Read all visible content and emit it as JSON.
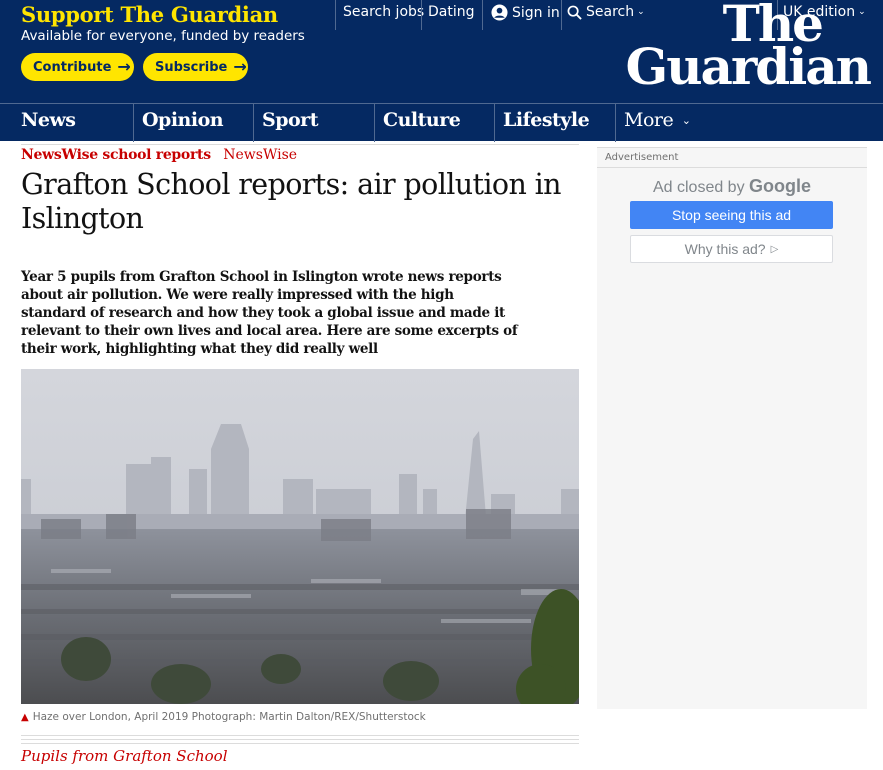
{
  "header": {
    "support_title": "Support The Guardian",
    "support_subtitle": "Available for everyone, funded by readers",
    "contribute_label": "Contribute",
    "subscribe_label": "Subscribe",
    "search_jobs": "Search jobs",
    "dating": "Dating",
    "sign_in": "Sign in",
    "search": "Search",
    "edition": "UK edition",
    "logo_line1": "The",
    "logo_line2": "Guardian",
    "colors": {
      "brand_blue": "#052962",
      "accent_yellow": "#ffe500",
      "news_red": "#c70000"
    }
  },
  "nav": {
    "items": [
      {
        "label": "News"
      },
      {
        "label": "Opinion"
      },
      {
        "label": "Sport"
      },
      {
        "label": "Culture"
      },
      {
        "label": "Lifestyle"
      },
      {
        "label": "More"
      }
    ]
  },
  "article": {
    "series": "NewsWise school reports",
    "section": "NewsWise",
    "headline": "Grafton School reports: air pollution in Islington",
    "standfirst": "Year 5 pupils from Grafton School in Islington wrote news reports about air pollution. We were really impressed with the high standard of research and how they took a global issue and made it relevant to their own lives and local area. Here are some excerpts of their work, highlighting what they did really well",
    "image_caption": "Haze over London, April 2019 Photograph: Martin Dalton/REX/Shutterstock",
    "byline": "Pupils from Grafton School"
  },
  "ad": {
    "label": "Advertisement",
    "closed_prefix": "Ad closed by",
    "closed_brand": "Google",
    "stop_label": "Stop seeing this ad",
    "why_label": "Why this ad?"
  }
}
